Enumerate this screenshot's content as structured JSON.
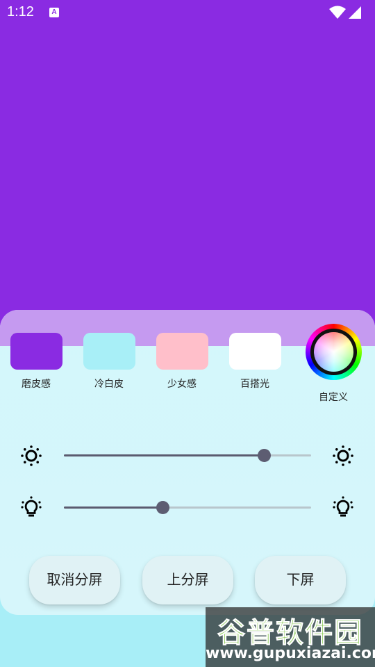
{
  "status_bar": {
    "time": "1:12",
    "notification_glyph": "A"
  },
  "screen": {
    "background_color": "#8a2be2"
  },
  "swatches": [
    {
      "label": "磨皮感",
      "color": "#8a2be2"
    },
    {
      "label": "冷白皮",
      "color": "#a8eff7"
    },
    {
      "label": "少女感",
      "color": "#ffbfca"
    },
    {
      "label": "百搭光",
      "color": "#ffffff"
    }
  ],
  "custom": {
    "label": "自定义",
    "icon": "color-wheel-icon"
  },
  "sliders": [
    {
      "name": "brightness",
      "icon": "sun-icon",
      "value": 0.81
    },
    {
      "name": "light",
      "icon": "lightbulb-icon",
      "value": 0.4
    }
  ],
  "buttons": {
    "cancel_split": "取消分屏",
    "upper_split": "上分屏",
    "lower_split": "下屏"
  },
  "watermark": {
    "line1": "谷普软件园",
    "line2": "www.gupuxiazai.com"
  }
}
